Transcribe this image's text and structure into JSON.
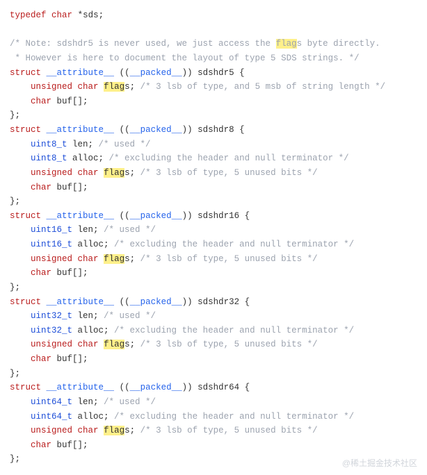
{
  "code": {
    "typedef": {
      "kw_typedef": "typedef",
      "kw_char": "char",
      "star_sds": "*sds;"
    },
    "note1": "/* Note: sdshdr5 is never used, we just access the ",
    "note1_hl": "flag",
    "note1_rest": "s byte directly.",
    "note2": " * However is here to document the layout of type 5 SDS strings. */",
    "struct_kw": "struct",
    "attr": "__attribute__",
    "packed_open": " ((",
    "packed": "__packed__",
    "packed_close": ")) ",
    "h5": "sdshdr5 {",
    "h8": "sdshdr8 {",
    "h16": "sdshdr16 {",
    "h32": "sdshdr32 {",
    "h64": "sdshdr64 {",
    "unsigned": "unsigned",
    "char": "char",
    "flags_pre": " ",
    "flag_hl": "flag",
    "flags_post": "s; ",
    "c_flags5": "/* 3 lsb of type, and 5 msb of string length */",
    "c_flags": "/* 3 lsb of type, 5 unused bits */",
    "buf_kw": "char",
    "buf": " buf[];",
    "close": "};",
    "u8": "uint8_t",
    "u16": "uint16_t",
    "u32": "uint32_t",
    "u64": "uint64_t",
    "len": " len; ",
    "c_used": "/* used */",
    "alloc": " alloc; ",
    "c_alloc": "/* excluding the header and null terminator */"
  },
  "watermark": "@稀土掘金技术社区"
}
